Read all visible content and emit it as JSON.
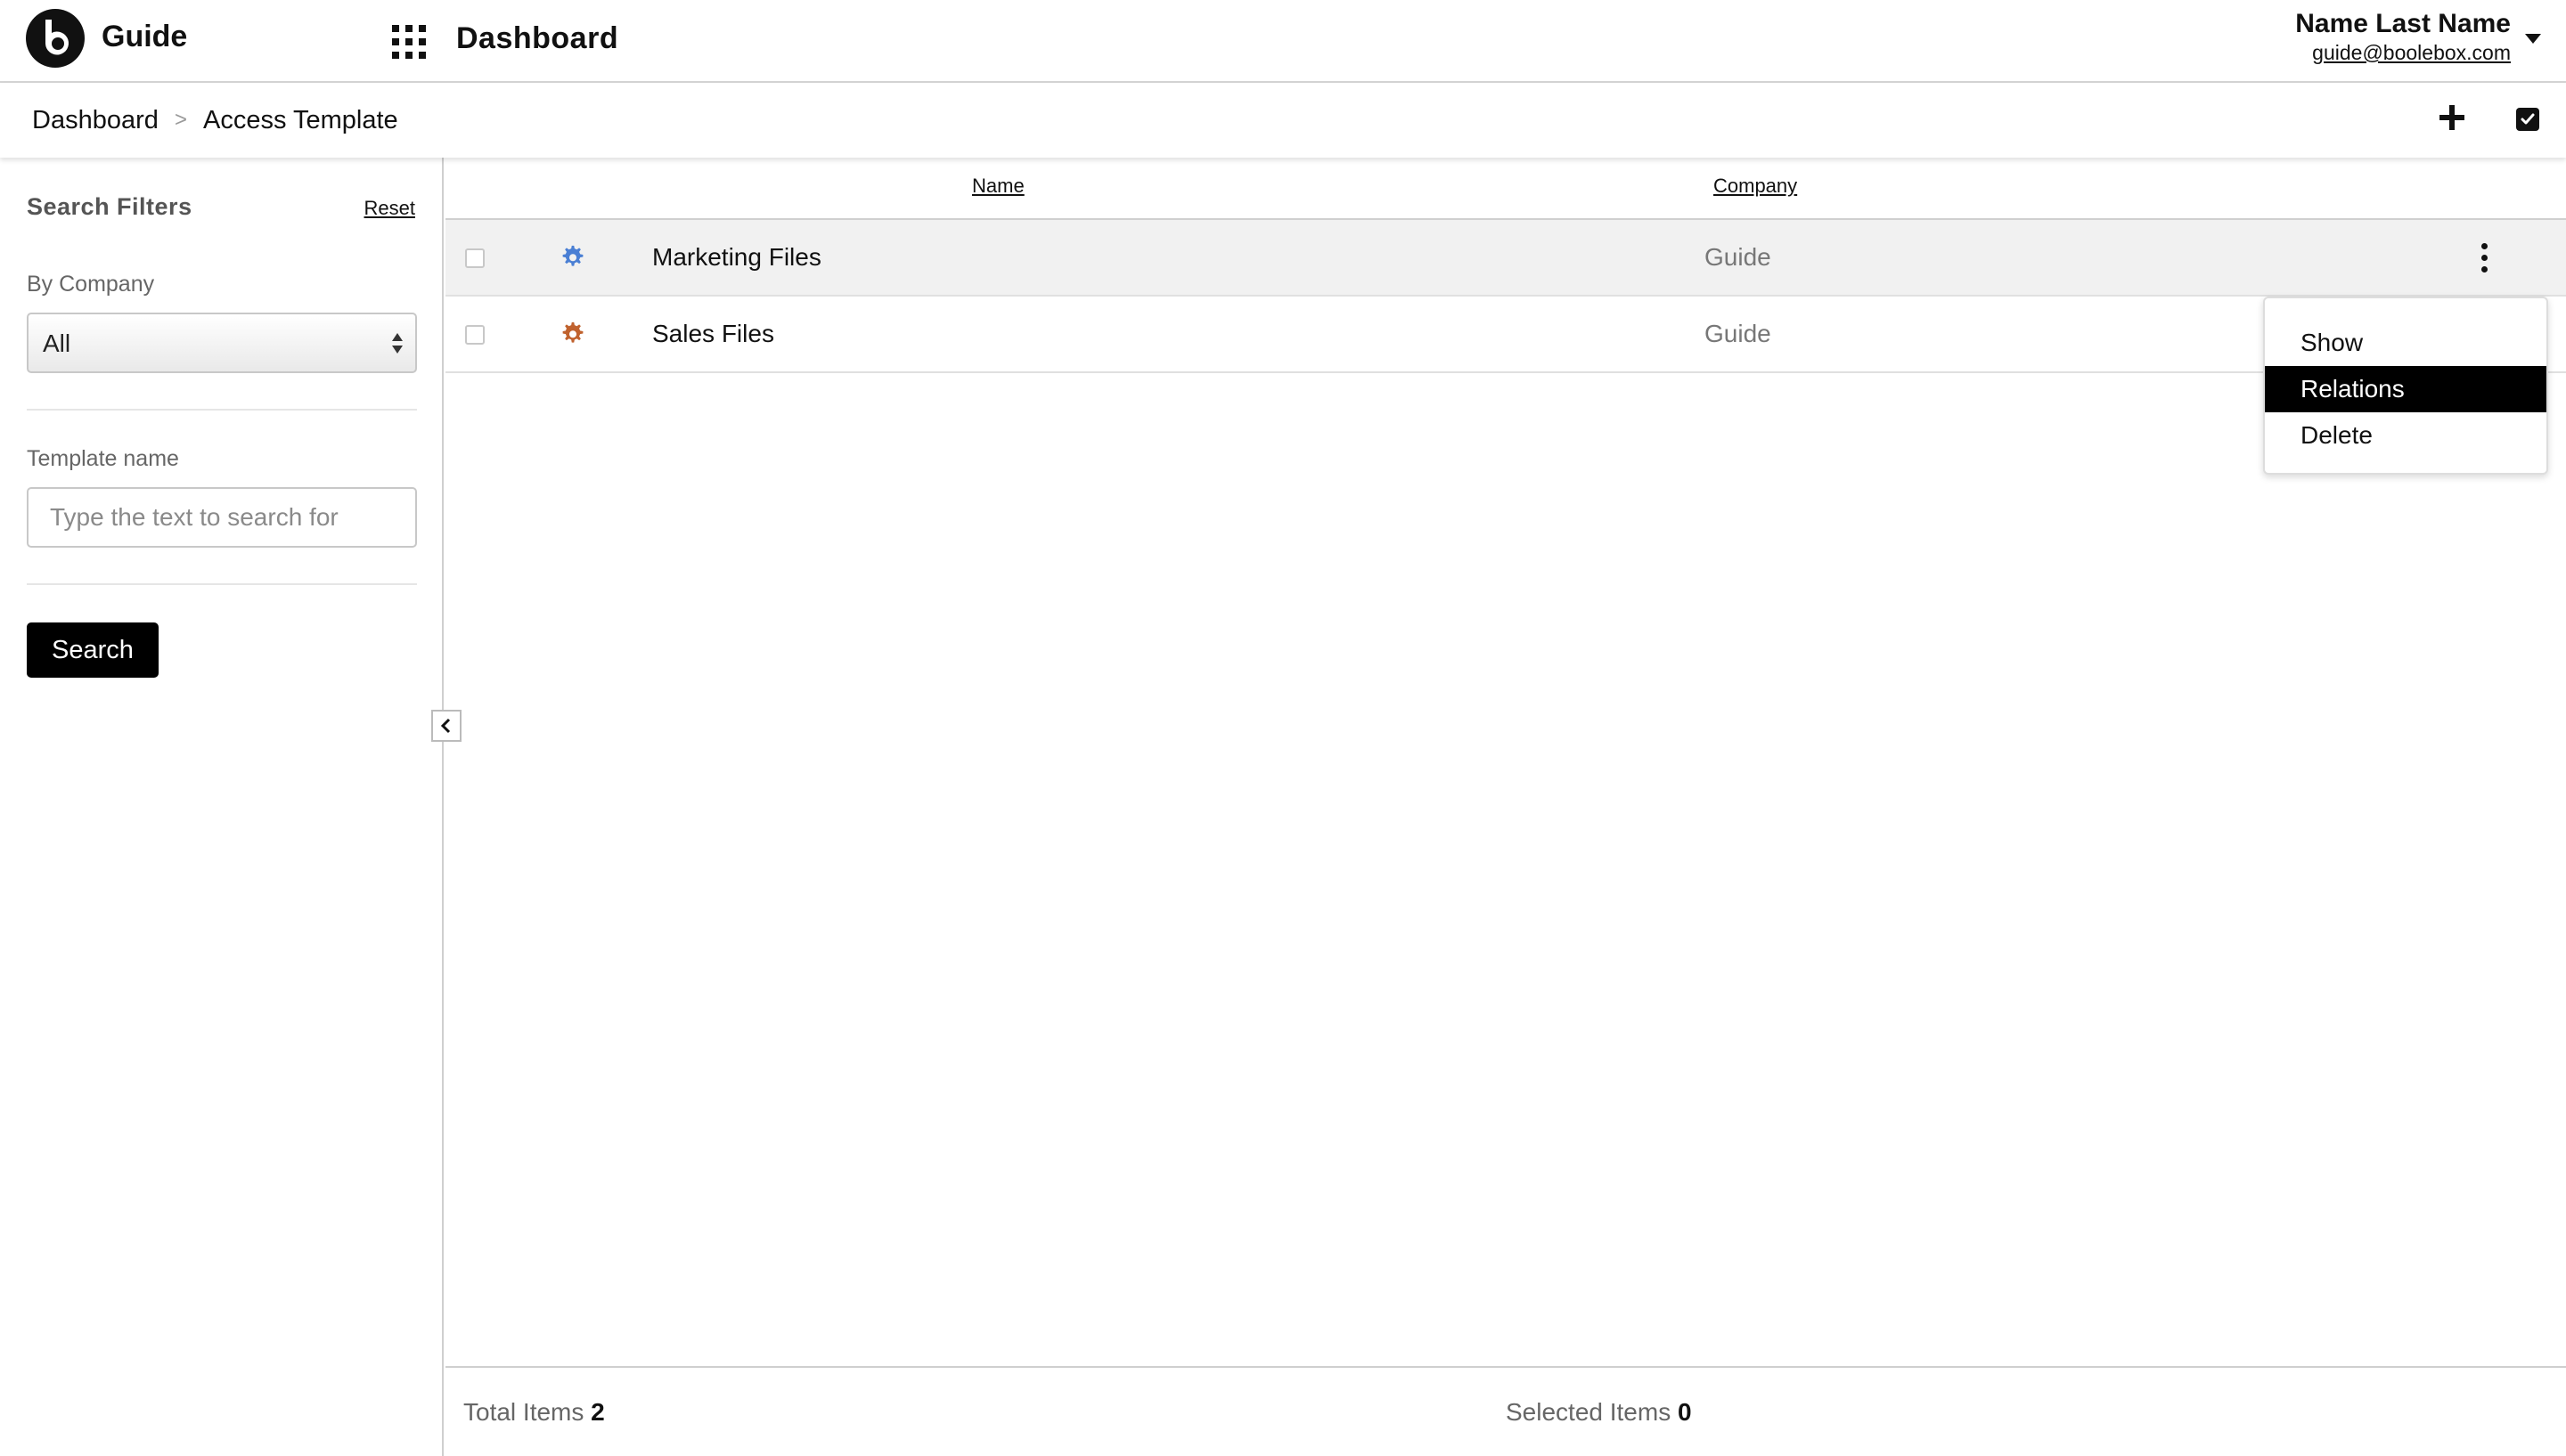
{
  "header": {
    "app_name": "Guide",
    "page_title": "Dashboard",
    "user_name": "Name Last Name",
    "user_email": "guide@boolebox.com"
  },
  "breadcrumb": {
    "home": "Dashboard",
    "separator": ">",
    "current": "Access Template"
  },
  "toolbar": {
    "add_icon": "plus-icon",
    "select_icon": "checkbox-check-icon"
  },
  "sidebar": {
    "title": "Search Filters",
    "reset_label": "Reset",
    "company_label": "By Company",
    "company_value": "All",
    "template_label": "Template name",
    "template_placeholder": "Type the text to search for",
    "template_value": "",
    "search_label": "Search"
  },
  "table": {
    "columns": [
      "Name",
      "Company"
    ],
    "rows": [
      {
        "name": "Marketing Files",
        "company": "Guide",
        "icon": "gear-icon",
        "icon_color": "#4a7fd4"
      },
      {
        "name": "Sales Files",
        "company": "Guide",
        "icon": "gear-icon",
        "icon_color": "#c0622e"
      }
    ]
  },
  "context_menu": {
    "items": [
      "Show",
      "Relations",
      "Delete"
    ],
    "active": "Relations"
  },
  "footer": {
    "total_label": "Total Items",
    "total_value": "2",
    "selected_label": "Selected Items",
    "selected_value": "0"
  },
  "colors": {
    "accent": "#000000",
    "row_hover": "#f1f1f1"
  }
}
